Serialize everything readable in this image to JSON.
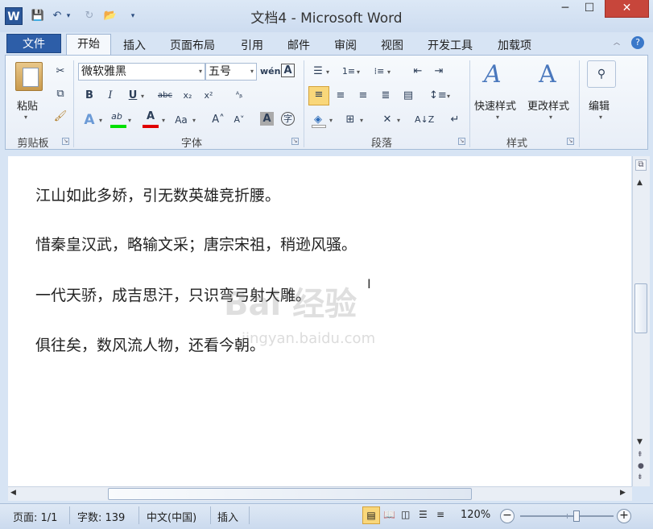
{
  "window": {
    "title": "文档4 - Microsoft Word",
    "word_icon_letter": "W",
    "minimize": "─",
    "restore": "☐",
    "close": "✕"
  },
  "qat": {
    "save": "💾",
    "undo": "↶",
    "undo_more": "▾",
    "redo": "↻",
    "open": "📂",
    "customize": "▾"
  },
  "tabs": {
    "file": "文件",
    "home": "开始",
    "insert": "插入",
    "layout": "页面布局",
    "references": "引用",
    "mailings": "邮件",
    "review": "审阅",
    "view": "视图",
    "developer": "开发工具",
    "addins": "加载项",
    "help": "?"
  },
  "ribbon": {
    "clipboard": {
      "paste": "粘贴",
      "label": "剪贴板"
    },
    "font": {
      "name": "微软雅黑",
      "size": "五号",
      "label": "字体"
    },
    "paragraph": {
      "label": "段落"
    },
    "styles": {
      "quick": "快速样式",
      "change": "更改样式",
      "label": "样式"
    },
    "editing": {
      "label": "编辑"
    }
  },
  "document": {
    "paragraphs": [
      "江山如此多娇，引无数英雄竞折腰。",
      "惜秦皇汉武，略输文采；唐宗宋祖，稍逊风骚。",
      "一代天骄，成吉思汗，只识弯弓射大雕。",
      "俱往矣，数风流人物，还看今朝。"
    ]
  },
  "watermark": {
    "brand": "Bai 经验",
    "url": "jingyan.baidu.com"
  },
  "status": {
    "page": "页面: 1/1",
    "words": "字数: 139",
    "language": "中文(中国)",
    "mode": "插入",
    "zoom": "120%",
    "zoom_level": 0.6
  },
  "colors": {
    "highlight": "#00e000",
    "font_color": "#e00000",
    "file_tab": "#2d5ea8",
    "close": "#c7463b"
  }
}
